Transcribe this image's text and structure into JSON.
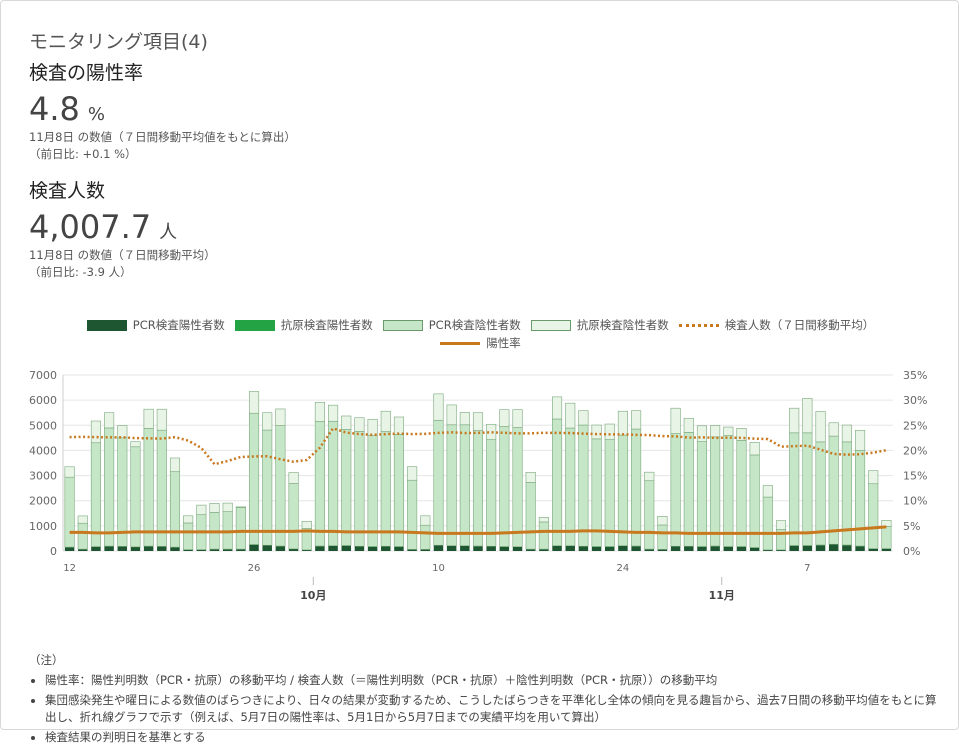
{
  "header": {
    "section_title": "モニタリング項目(4)"
  },
  "positivity": {
    "title": "検査の陽性率",
    "value": "4.8",
    "unit": "%",
    "note": "11月8日 の数値（７日間移動平均値をもとに算出）",
    "diff": "（前日比: +0.1 %）"
  },
  "tests": {
    "title": "検査人数",
    "value": "4,007.7",
    "unit": "人",
    "note": "11月8日 の数値（７日間移動平均）",
    "diff": "（前日比: -3.9 人）"
  },
  "legend": {
    "pcr_pos": "PCR検査陽性者数",
    "antigen_pos": "抗原検査陽性者数",
    "pcr_neg": "PCR検査陰性者数",
    "antigen_neg": "抗原検査陰性者数",
    "avg_tests": "検査人数（７日間移動平均）",
    "rate": "陽性率"
  },
  "colors": {
    "pcr_pos": "#1e5631",
    "antigen_pos": "#23a343",
    "pcr_neg": "#c6e6c8",
    "antigen_neg": "#e8f4e6",
    "avg_tests": "#c8781d",
    "rate": "#c8781d"
  },
  "chart_data": {
    "type": "bar",
    "stacked": true,
    "x_start": "2020-09-12",
    "x_end": "2020-11-08",
    "x_ticks": [
      "12",
      "26",
      "10",
      "24",
      "7"
    ],
    "month_labels": [
      "10月",
      "11月"
    ],
    "y_left": {
      "min": 0,
      "max": 7000,
      "ticks": [
        "0",
        "1000",
        "2000",
        "3000",
        "4000",
        "5000",
        "6000",
        "7000"
      ]
    },
    "y_right": {
      "min": 0,
      "max": 35,
      "ticks": [
        "0%",
        "5%",
        "10%",
        "15%",
        "20%",
        "25%",
        "30%",
        "35%"
      ]
    },
    "grid": true,
    "legend_position": "top",
    "series": [
      {
        "name": "PCR検査陽性者数",
        "values": [
          150,
          70,
          170,
          190,
          180,
          160,
          190,
          180,
          150,
          50,
          50,
          70,
          70,
          70,
          250,
          220,
          190,
          80,
          40,
          190,
          200,
          210,
          180,
          170,
          180,
          170,
          60,
          60,
          220,
          200,
          200,
          190,
          180,
          170,
          160,
          70,
          70,
          200,
          200,
          180,
          170,
          170,
          200,
          190,
          70,
          60,
          180,
          180,
          170,
          190,
          170,
          170,
          130,
          40,
          40,
          210,
          210,
          230,
          260,
          230,
          190,
          90,
          90
        ]
      },
      {
        "name": "抗原検査陽性者数",
        "values": [
          5,
          5,
          5,
          5,
          5,
          5,
          5,
          5,
          5,
          5,
          5,
          5,
          5,
          5,
          10,
          10,
          10,
          5,
          5,
          10,
          10,
          10,
          10,
          10,
          10,
          10,
          5,
          5,
          10,
          10,
          10,
          10,
          10,
          10,
          10,
          5,
          5,
          10,
          10,
          10,
          10,
          10,
          10,
          10,
          5,
          5,
          10,
          10,
          10,
          10,
          10,
          10,
          10,
          5,
          5,
          10,
          10,
          10,
          10,
          10,
          10,
          5,
          5
        ]
      },
      {
        "name": "PCR検査陰性者数",
        "values": [
          2780,
          1030,
          4130,
          4700,
          4320,
          3980,
          4680,
          4620,
          3000,
          1060,
          1390,
          1460,
          1490,
          1660,
          5220,
          4580,
          4790,
          2600,
          850,
          4950,
          4950,
          4620,
          4570,
          4410,
          4560,
          4460,
          2750,
          960,
          4970,
          4810,
          4810,
          4590,
          4240,
          4770,
          4740,
          2650,
          1080,
          5040,
          4680,
          4820,
          4280,
          4250,
          4400,
          4650,
          2720,
          970,
          4480,
          4530,
          4170,
          4340,
          4410,
          4220,
          3680,
          2100,
          810,
          4480,
          4480,
          4100,
          4300,
          4100,
          3800,
          2580,
          880
        ]
      },
      {
        "name": "抗原検査陰性者数",
        "values": [
          415,
          290,
          865,
          605,
          485,
          205,
          765,
          835,
          545,
          285,
          380,
          360,
          340,
          20,
          865,
          690,
          660,
          435,
          285,
          765,
          640,
          530,
          540,
          650,
          810,
          690,
          540,
          375,
          1050,
          790,
          490,
          710,
          610,
          670,
          710,
          405,
          185,
          880,
          990,
          570,
          550,
          620,
          950,
          730,
          340,
          345,
          1010,
          560,
          630,
          450,
          340,
          480,
          500,
          460,
          355,
          980,
          1370,
          1210,
          530,
          670,
          800,
          520,
          245
        ]
      },
      {
        "name": "検査人数（７日間移動平均）",
        "type": "line",
        "dashed": true,
        "values": [
          4530,
          4540,
          4530,
          4520,
          4520,
          4490,
          4480,
          4470,
          4530,
          4390,
          4100,
          3450,
          3580,
          3740,
          3760,
          3770,
          3650,
          3550,
          3620,
          4110,
          4880,
          4710,
          4650,
          4620,
          4650,
          4670,
          4650,
          4660,
          4700,
          4720,
          4690,
          4700,
          4720,
          4700,
          4680,
          4680,
          4700,
          4700,
          4690,
          4670,
          4650,
          4640,
          4640,
          4620,
          4610,
          4570,
          4560,
          4510,
          4520,
          4500,
          4510,
          4500,
          4470,
          4450,
          4150,
          4170,
          4190,
          4030,
          3860,
          3830,
          3850,
          3910,
          4010
        ]
      },
      {
        "name": "陽性率",
        "type": "line",
        "axis": "right",
        "values": [
          3.7,
          3.7,
          3.6,
          3.6,
          3.7,
          3.8,
          3.8,
          3.8,
          3.8,
          3.8,
          3.8,
          3.8,
          3.8,
          3.9,
          3.9,
          3.9,
          3.9,
          3.9,
          4.0,
          3.9,
          3.9,
          3.8,
          3.8,
          3.8,
          3.8,
          3.8,
          3.7,
          3.6,
          3.5,
          3.5,
          3.5,
          3.5,
          3.5,
          3.6,
          3.7,
          3.8,
          3.9,
          3.9,
          3.9,
          4.0,
          4.0,
          3.9,
          3.8,
          3.7,
          3.7,
          3.6,
          3.6,
          3.5,
          3.5,
          3.5,
          3.5,
          3.5,
          3.5,
          3.5,
          3.5,
          3.6,
          3.6,
          3.8,
          4.0,
          4.2,
          4.4,
          4.6,
          4.8
        ]
      }
    ]
  },
  "footnote": {
    "heading": "（注）",
    "items": [
      "陽性率：陽性判明数（PCR・抗原）の移動平均 / 検査人数（＝陽性判明数（PCR・抗原）＋陰性判明数（PCR・抗原））の移動平均",
      "集団感染発生や曜日による数値のばらつきにより、日々の結果が変動するため、こうしたばらつきを平準化し全体の傾向を見る趣旨から、過去7日間の移動平均値をもとに算出し、折れ線グラフで示す（例えば、5月7日の陽性率は、5月1日から5月7日までの実績平均を用いて算出）",
      "検査結果の判明日を基準とする"
    ]
  }
}
